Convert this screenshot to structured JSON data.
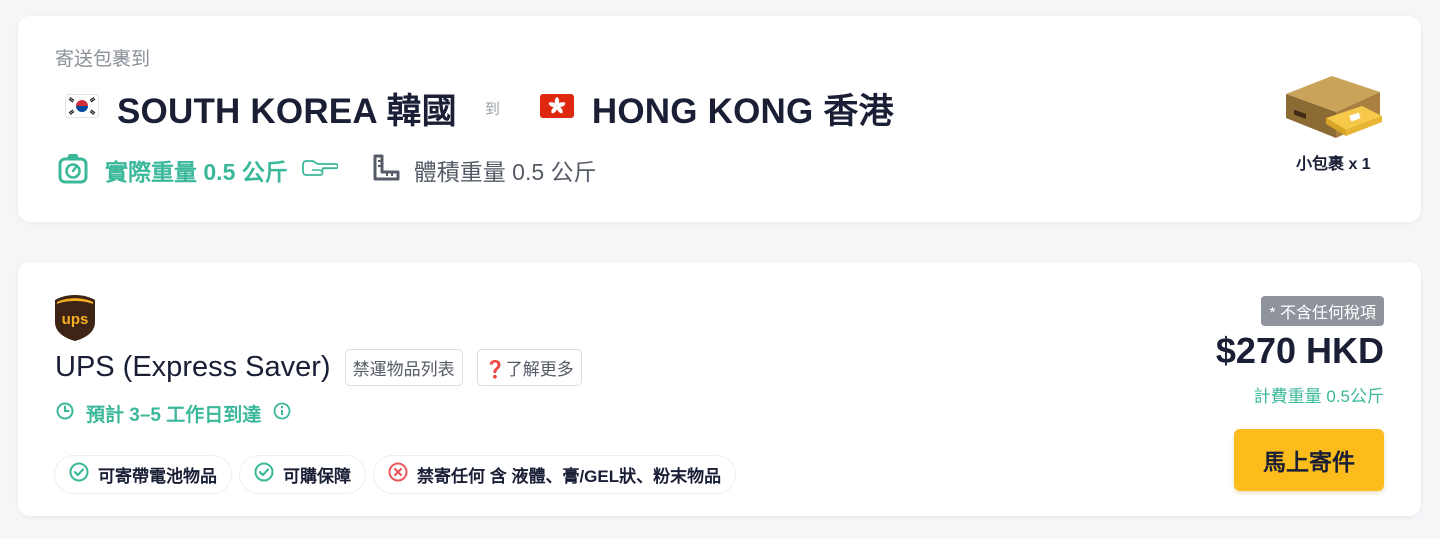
{
  "route": {
    "caption": "寄送包裹到",
    "origin": {
      "name": "SOUTH KOREA 韓國",
      "flag_icon": "south-korea-flag"
    },
    "to_label": "到",
    "destination": {
      "name": "HONG KONG 香港",
      "flag_icon": "hong-kong-flag"
    },
    "actual_weight": "實際重量 0.5 公斤",
    "volumetric_weight": "體積重量 0.5 公斤",
    "parcel": {
      "label": "小包裹 x 1",
      "icon": "parcel-box-icon"
    }
  },
  "quote": {
    "carrier_logo": "ups-logo",
    "service_name": "UPS (Express Saver)",
    "prohibited_list_label": "禁運物品列表",
    "learn_more_label": "❓了解更多",
    "eta": "預計 3–5 工作日到達",
    "features": [
      {
        "label": "可寄帶電池物品",
        "status": "allowed"
      },
      {
        "label": "可購保障",
        "status": "allowed"
      },
      {
        "label": "禁寄任何 含 液體、膏/GEL狀、粉末物品",
        "status": "prohibited"
      }
    ],
    "tax_note": "* 不含任何稅項",
    "price": "$270 HKD",
    "billing_weight": "計費重量 0.5公斤",
    "ship_button": "馬上寄件"
  },
  "colors": {
    "accent_green": "#3bb89a",
    "cta_yellow": "#fbbc1c",
    "prohibited_red": "#e8595b",
    "ups_brown": "#3d2415",
    "ups_gold": "#f5b021"
  }
}
